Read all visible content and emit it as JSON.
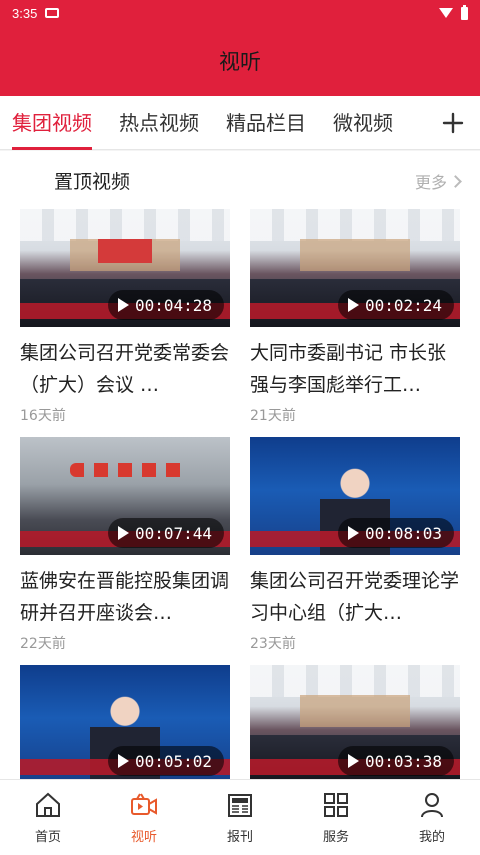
{
  "status_bar": {
    "time": "3:35"
  },
  "header": {
    "title": "视听"
  },
  "tabs": [
    {
      "label": "集团视频",
      "active": true
    },
    {
      "label": "热点视频",
      "active": false
    },
    {
      "label": "精品栏目",
      "active": false
    },
    {
      "label": "微视频",
      "active": false
    }
  ],
  "add_tab_icon": "plus-icon",
  "section": {
    "title": "置顶视频",
    "more_label": "更多"
  },
  "videos": [
    {
      "title": "集团公司召开党委常委会（扩大）会议 …",
      "duration": "00:04:28",
      "age": "16天前",
      "thumb": "meeting"
    },
    {
      "title": "大同市委副书记 市长张强与李国彪举行工…",
      "duration": "00:02:24",
      "age": "21天前",
      "thumb": "meeting"
    },
    {
      "title": "蓝佛安在晋能控股集团调研并召开座谈会…",
      "duration": "00:07:44",
      "age": "22天前",
      "thumb": "site"
    },
    {
      "title": "集团公司召开党委理论学习中心组（扩大…",
      "duration": "00:08:03",
      "age": "23天前",
      "thumb": "studio"
    },
    {
      "title": "",
      "duration": "00:05:02",
      "age": "",
      "thumb": "studio"
    },
    {
      "title": "",
      "duration": "00:03:38",
      "age": "",
      "thumb": "meeting"
    }
  ],
  "bottom_nav": [
    {
      "label": "首页",
      "icon": "home-icon",
      "active": false
    },
    {
      "label": "视听",
      "icon": "video-camera-icon",
      "active": true
    },
    {
      "label": "报刊",
      "icon": "newspaper-icon",
      "active": false
    },
    {
      "label": "服务",
      "icon": "grid-icon",
      "active": false
    },
    {
      "label": "我的",
      "icon": "user-icon",
      "active": false
    }
  ],
  "colors": {
    "brand_red": "#e0203c",
    "active_nav": "#e85a2c",
    "muted": "#999999"
  }
}
